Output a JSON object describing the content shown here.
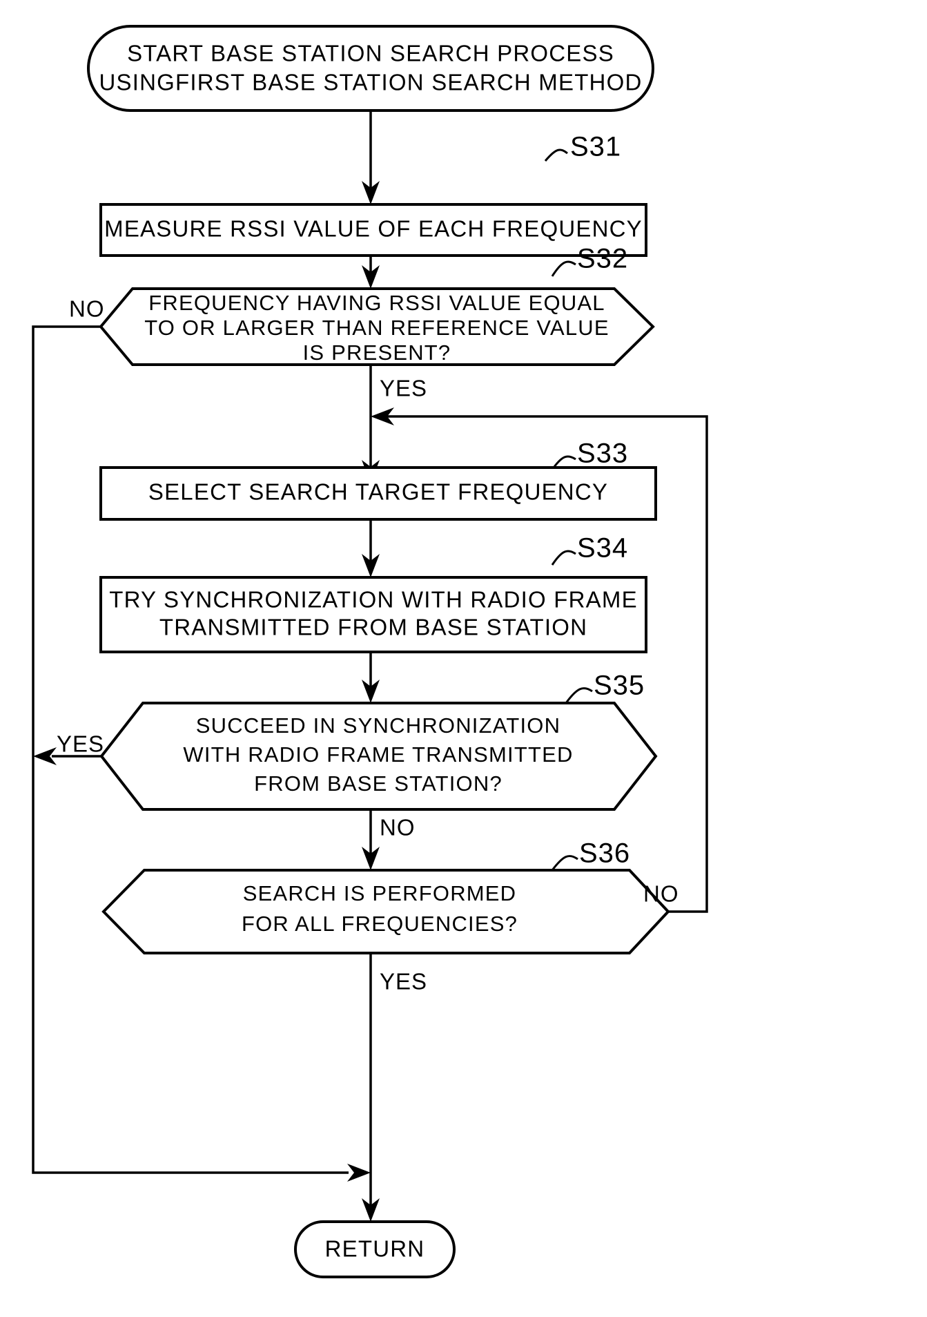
{
  "diagram": {
    "type": "flowchart",
    "title": "Base station search process using first base station search method",
    "nodes": [
      {
        "id": "start",
        "shape": "terminator",
        "lines": [
          "START BASE STATION SEARCH PROCESS",
          "USINGFIRST BASE STATION SEARCH METHOD"
        ]
      },
      {
        "id": "s31",
        "shape": "process",
        "step": "S31",
        "lines": [
          "MEASURE RSSI VALUE OF EACH FREQUENCY"
        ]
      },
      {
        "id": "s32",
        "shape": "decision-hexagon",
        "step": "S32",
        "lines": [
          "FREQUENCY HAVING RSSI VALUE EQUAL",
          "TO OR LARGER THAN REFERENCE VALUE",
          "IS PRESENT?"
        ]
      },
      {
        "id": "s33",
        "shape": "process",
        "step": "S33",
        "lines": [
          "SELECT SEARCH TARGET FREQUENCY"
        ]
      },
      {
        "id": "s34",
        "shape": "process",
        "step": "S34",
        "lines": [
          "TRY SYNCHRONIZATION WITH RADIO FRAME",
          "TRANSMITTED FROM BASE STATION"
        ]
      },
      {
        "id": "s35",
        "shape": "decision-hexagon",
        "step": "S35",
        "lines": [
          "SUCCEED IN SYNCHRONIZATION",
          "WITH RADIO FRAME TRANSMITTED",
          "FROM BASE STATION?"
        ]
      },
      {
        "id": "s36",
        "shape": "decision-hexagon",
        "step": "S36",
        "lines": [
          "SEARCH IS PERFORMED",
          "FOR ALL FREQUENCIES?"
        ]
      },
      {
        "id": "return",
        "shape": "terminator",
        "lines": [
          "RETURN"
        ]
      }
    ],
    "edge_labels": {
      "s32_no": "NO",
      "s32_yes": "YES",
      "s35_yes": "YES",
      "s35_no": "NO",
      "s36_no": "NO",
      "s36_yes": "YES"
    },
    "step_labels": {
      "s31": "S31",
      "s32": "S32",
      "s33": "S33",
      "s34": "S34",
      "s35": "S35",
      "s36": "S36"
    },
    "colors": {
      "ink": "#000000",
      "paper": "#ffffff"
    }
  }
}
